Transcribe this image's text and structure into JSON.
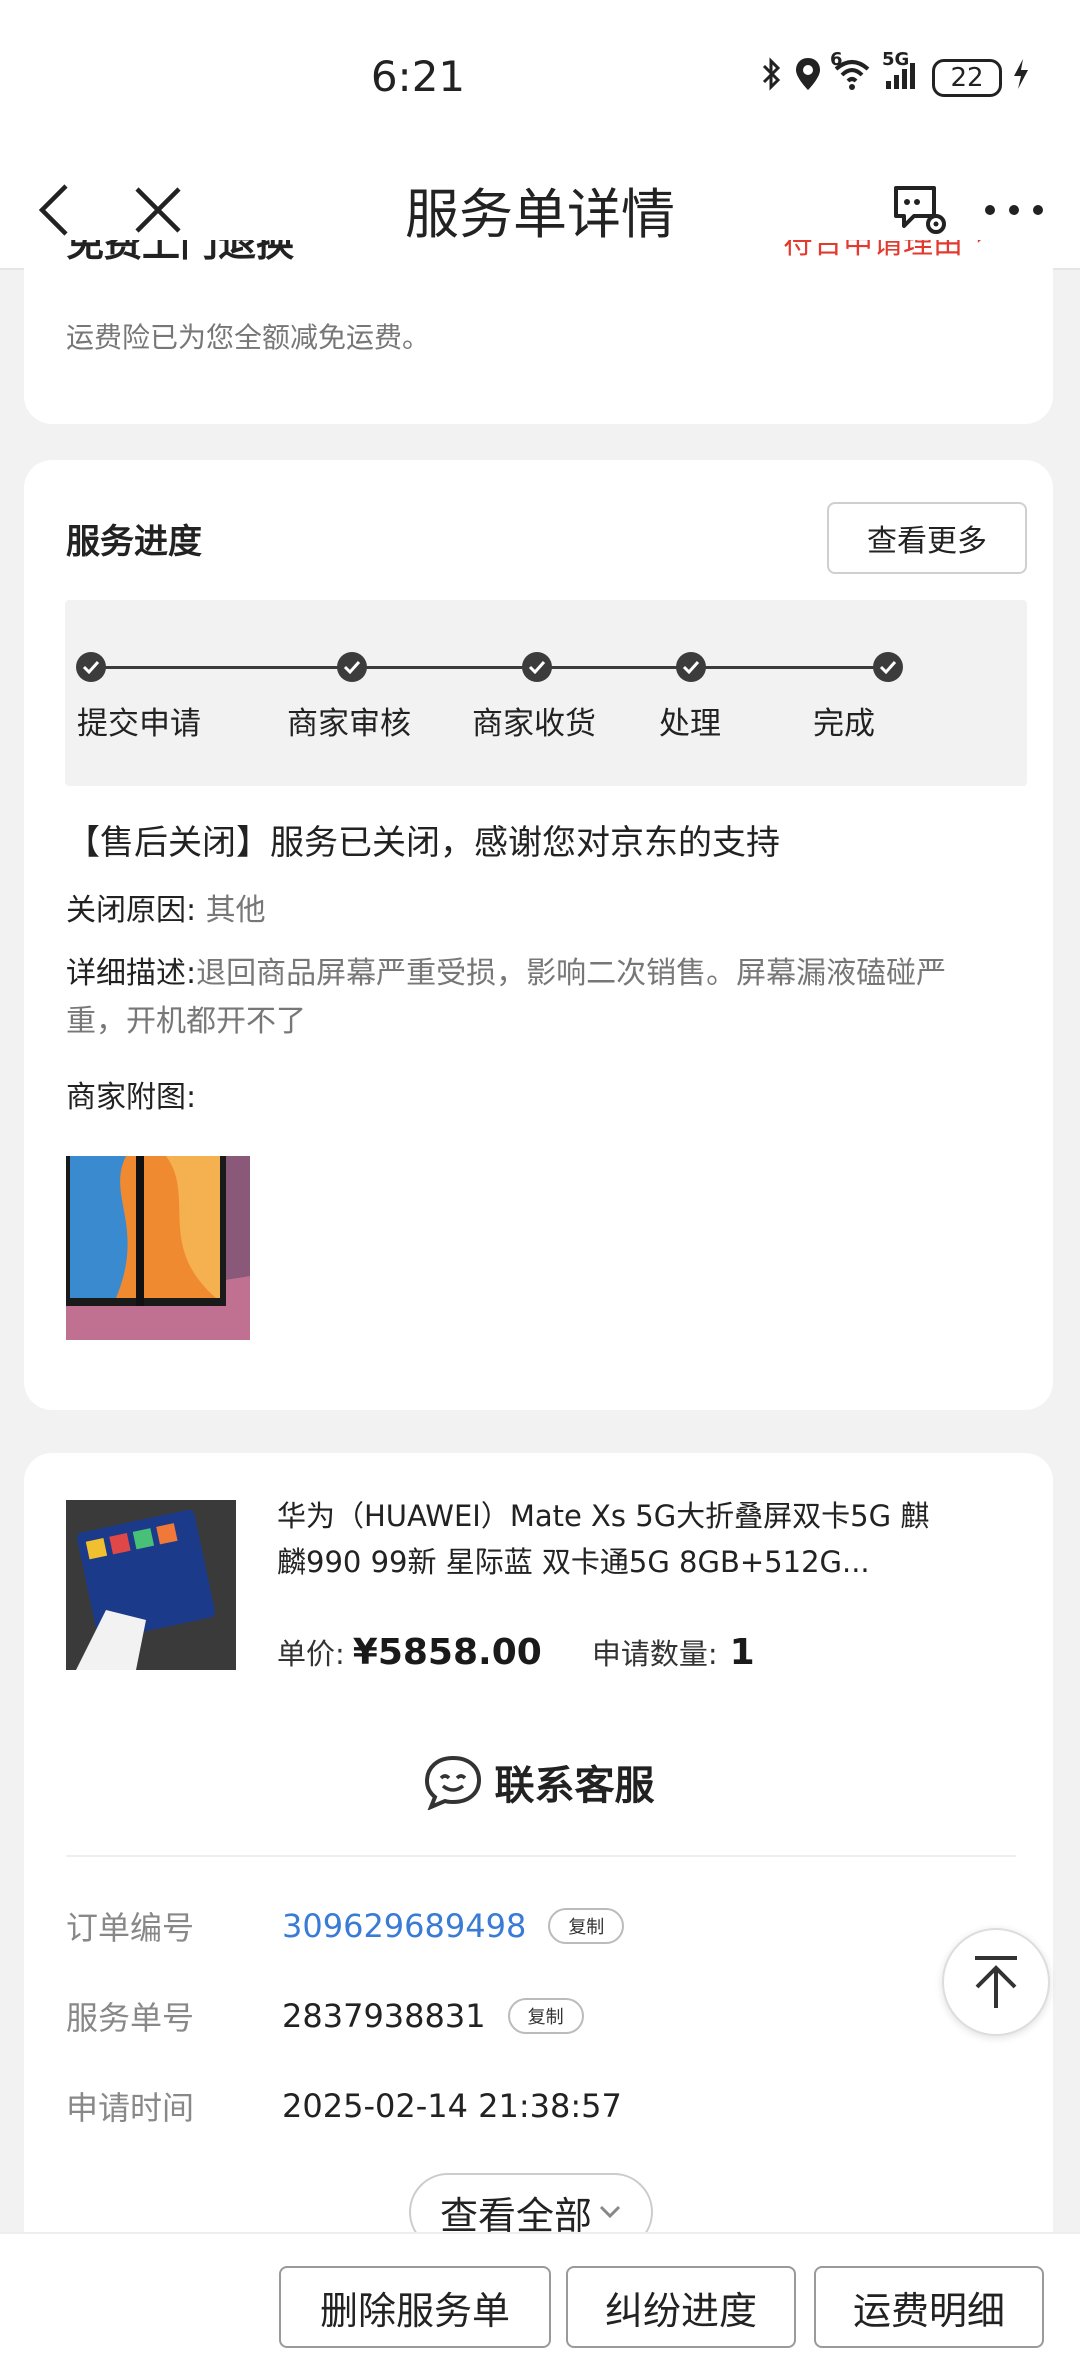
{
  "status_bar": {
    "time": "6:21",
    "net_top": "6",
    "net_5g": "5G",
    "battery": "22"
  },
  "titlebar": {
    "title": "服务单详情"
  },
  "top_card": {
    "title_partial": "免费上门退换",
    "link_partial": "符合申请理由",
    "note": "运费险已为您全额减免运费。"
  },
  "progress": {
    "title": "服务进度",
    "view_more": "查看更多",
    "steps": [
      "提交申请",
      "商家审核",
      "商家收货",
      "处理",
      "完成"
    ],
    "status_message": "【售后关闭】服务已关闭，感谢您对京东的支持",
    "close_reason_label": "关闭原因:",
    "close_reason": "其他",
    "description_label": "详细描述:",
    "description": "退回商品屏幕严重受损，影响二次销售。屏幕漏液磕碰严重，开机都开不了",
    "attachment_label": "商家附图:"
  },
  "product": {
    "name": "华为（HUAWEI）Mate Xs 5G大折叠屏双卡5G 麒麟990  99新 星际蓝 双卡通5G 8GB+512G...",
    "unit_price_label": "单价:",
    "unit_price": "¥5858.00",
    "qty_label": "申请数量:",
    "qty": "1"
  },
  "contact": {
    "label": "联系客服"
  },
  "order_info": {
    "rows": [
      {
        "key": "订单编号",
        "value": "309629689498",
        "copy": "复制"
      },
      {
        "key": "服务单号",
        "value": "2837938831",
        "copy": "复制"
      },
      {
        "key": "申请时间",
        "value": "2025-02-14 21:38:57"
      }
    ],
    "view_all": "查看全部"
  },
  "bottom_actions": {
    "delete": "删除服务单",
    "dispute": "纠纷进度",
    "shipping": "运费明细"
  },
  "colors": {
    "accent_link": "#3a7bd5",
    "warning_red": "#e23a2e"
  }
}
